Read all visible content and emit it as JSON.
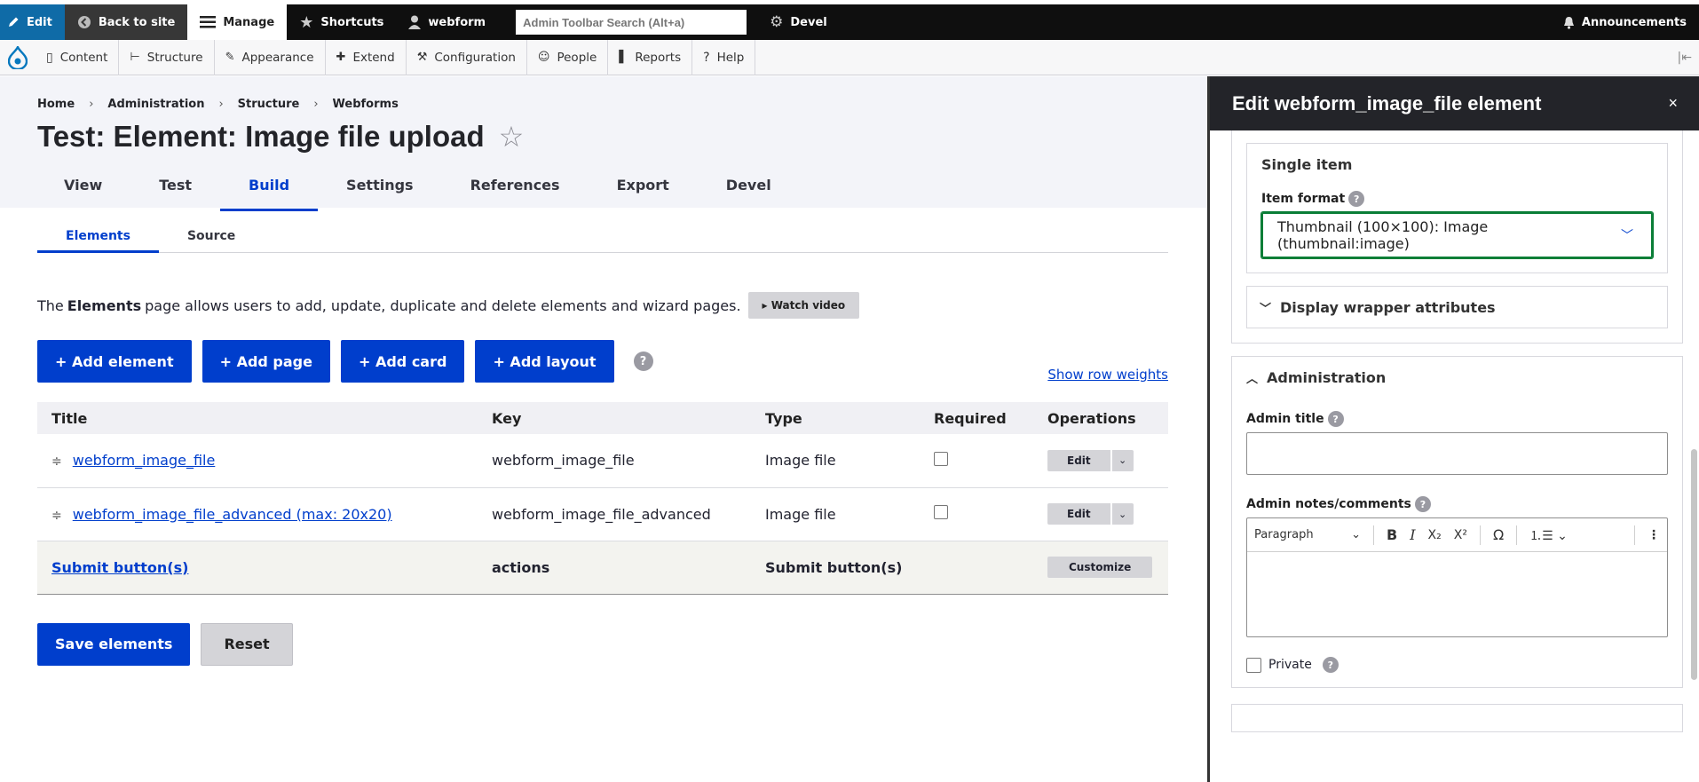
{
  "toolbar": {
    "edit": "Edit",
    "back": "Back to site",
    "manage": "Manage",
    "shortcuts": "Shortcuts",
    "user": "webform",
    "search_placeholder": "Admin Toolbar Search (Alt+a)",
    "devel": "Devel",
    "announcements": "Announcements"
  },
  "tray": [
    "Content",
    "Structure",
    "Appearance",
    "Extend",
    "Configuration",
    "People",
    "Reports",
    "Help"
  ],
  "breadcrumb": [
    "Home",
    "Administration",
    "Structure",
    "Webforms"
  ],
  "page_title": "Test: Element: Image file upload",
  "tabs": [
    "View",
    "Test",
    "Build",
    "Settings",
    "References",
    "Export",
    "Devel"
  ],
  "subtabs": [
    "Elements",
    "Source"
  ],
  "description": {
    "pre": "The",
    "bold": "Elements",
    "post": "page allows users to add, update, duplicate and delete elements and wizard pages.",
    "watch_video": "▸ Watch video"
  },
  "actions": {
    "add_element": "+ Add element",
    "add_page": "+ Add page",
    "add_card": "+ Add card",
    "add_layout": "+ Add layout",
    "help": "?",
    "show_row_weights": "Show row weights"
  },
  "table": {
    "headers": [
      "Title",
      "Key",
      "Type",
      "Required",
      "Operations"
    ],
    "rows": [
      {
        "title": "webform_image_file",
        "key": "webform_image_file",
        "type": "Image file",
        "op": "Edit"
      },
      {
        "title": "webform_image_file_advanced (max: 20x20)",
        "key": "webform_image_file_advanced",
        "type": "Image file",
        "op": "Edit"
      }
    ],
    "footer": {
      "title": "Submit button(s)",
      "key": "actions",
      "type": "Submit button(s)",
      "op": "Customize"
    }
  },
  "bottom": {
    "save": "Save elements",
    "reset": "Reset"
  },
  "dialog": {
    "title": "Edit webform_image_file element",
    "close": "×",
    "single_item": "Single item",
    "item_format_label": "Item format",
    "item_format_value": "Thumbnail (100×100): Image (thumbnail:image)",
    "display_wrapper": "Display wrapper attributes",
    "administration": "Administration",
    "admin_title": "Admin title",
    "admin_notes": "Admin notes/comments",
    "paragraph": "Paragraph",
    "private": "Private"
  },
  "colors": {
    "primary": "#003ecc",
    "toolbar": "#0f0f0f",
    "focus_green": "#0a7e37"
  }
}
